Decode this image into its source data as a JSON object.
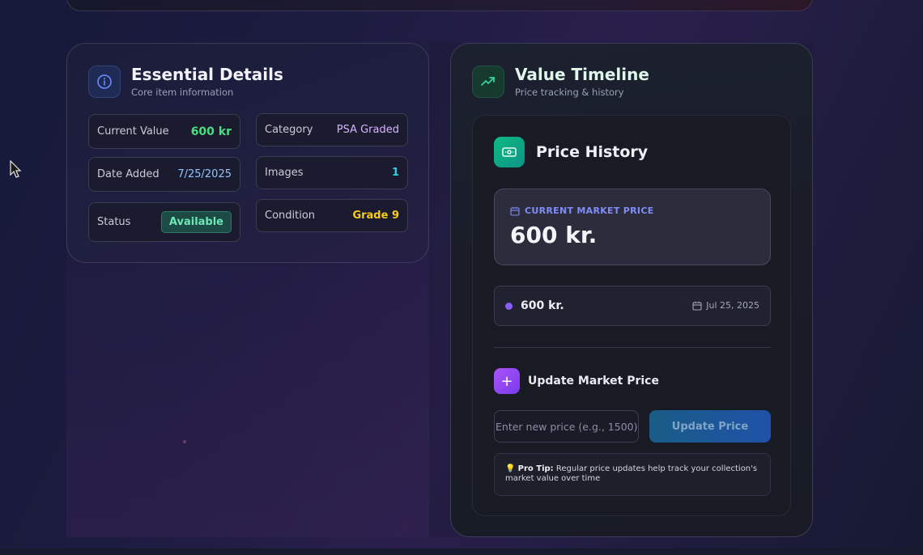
{
  "details": {
    "title": "Essential Details",
    "subtitle": "Core item information",
    "icon": "info-icon",
    "fields": {
      "current_value": {
        "label": "Current Value",
        "value": "600 kr"
      },
      "date_added": {
        "label": "Date Added",
        "value": "7/25/2025"
      },
      "status": {
        "label": "Status",
        "value": "Available"
      },
      "category": {
        "label": "Category",
        "value": "PSA Graded"
      },
      "images": {
        "label": "Images",
        "value": "1"
      },
      "condition": {
        "label": "Condition",
        "value": "Grade 9"
      }
    }
  },
  "timeline": {
    "title": "Value Timeline",
    "subtitle": "Price tracking & history",
    "icon": "trending-up-icon",
    "price_history": {
      "title": "Price History",
      "icon": "banknote-icon",
      "market_label": "CURRENT MARKET PRICE",
      "market_value": "600 kr.",
      "entries": [
        {
          "value": "600 kr.",
          "date": "Jul 25, 2025"
        }
      ]
    },
    "update": {
      "title": "Update Market Price",
      "placeholder": "Enter new price (e.g., 1500)",
      "button": "Update Price",
      "tip_label": "Pro Tip:",
      "tip_text": "Regular price updates help track your collection's market value over time",
      "tip_icon": "💡"
    }
  },
  "colors": {
    "value_green": "#4ade80",
    "status_badge": "#6ee7b7",
    "category_purple": "#d8b4fe",
    "images_cyan": "#22d3ee",
    "condition_yellow": "#facc15",
    "market_label": "#818cf8",
    "entry_dot": "#8b5cf6"
  }
}
